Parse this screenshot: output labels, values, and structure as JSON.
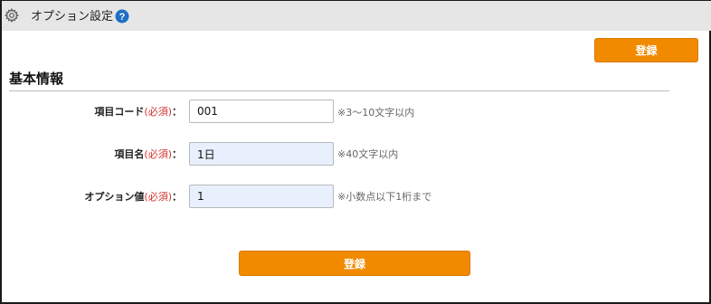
{
  "header": {
    "title": "オプション設定",
    "icons": {
      "settings": "gear-icon",
      "help": "help-icon"
    },
    "help_color": "#1f6fc5"
  },
  "actions": {
    "register_label": "登録",
    "accent_color": "#f28a00"
  },
  "section": {
    "title": "基本情報"
  },
  "form": {
    "required_mark": "(必須)",
    "colon": "：",
    "fields": [
      {
        "label": "項目コード",
        "value": "001",
        "hint": "※3～10文字以内"
      },
      {
        "label": "項目名",
        "value": "1日",
        "hint": "※40文字以内"
      },
      {
        "label": "オプション値",
        "value": "1",
        "hint": "※小数点以下1桁まで"
      }
    ]
  }
}
